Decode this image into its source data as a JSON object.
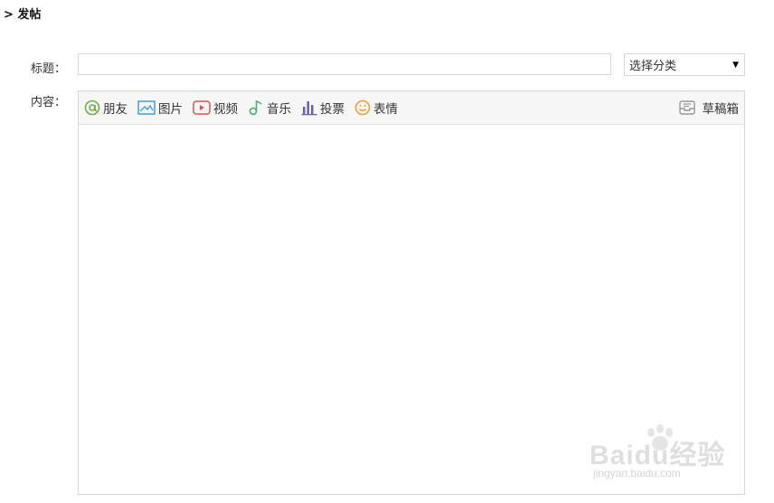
{
  "page": {
    "title": "> 发帖"
  },
  "form": {
    "title_label": "标题：",
    "title_value": "",
    "category_selected": "选择分类",
    "content_label": "内容：",
    "content_value": ""
  },
  "toolbar": {
    "items": [
      {
        "label": "朋友",
        "icon": "at-icon",
        "color": "#6ab04c"
      },
      {
        "label": "图片",
        "icon": "image-icon",
        "color": "#3f9fd6"
      },
      {
        "label": "视频",
        "icon": "video-icon",
        "color": "#e0524a"
      },
      {
        "label": "音乐",
        "icon": "music-icon",
        "color": "#3fb36b"
      },
      {
        "label": "投票",
        "icon": "vote-icon",
        "color": "#6f5fb3"
      },
      {
        "label": "表情",
        "icon": "emoji-icon",
        "color": "#f39c2b"
      }
    ],
    "drafts": {
      "label": "草稿箱",
      "icon": "drafts-icon"
    }
  },
  "watermark": {
    "main": "Baidu经验",
    "sub": "jingyan.baidu.com"
  }
}
